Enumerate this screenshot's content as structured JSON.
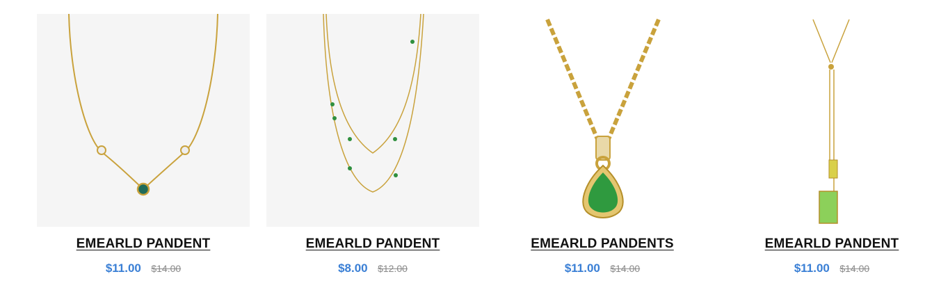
{
  "products": [
    {
      "title": "EMEARLD PANDENT",
      "price": "$11.00",
      "old_price": "$14.00",
      "image": "necklace-emerald-bezel-image"
    },
    {
      "title": "EMEARLD PANDENT",
      "price": "$8.00",
      "old_price": "$12.00",
      "image": "necklace-double-strand-image"
    },
    {
      "title": "EMEARLD PANDENTS",
      "price": "$11.00",
      "old_price": "$14.00",
      "image": "necklace-pear-drop-image"
    },
    {
      "title": "EMEARLD PANDENT",
      "price": "$11.00",
      "old_price": "$14.00",
      "image": "necklace-lariat-image"
    }
  ],
  "colors": {
    "price": "#3a7fd5",
    "old_price": "#8a8a8a",
    "gold": "#c9a23c",
    "emerald": "#2f8f3e"
  }
}
